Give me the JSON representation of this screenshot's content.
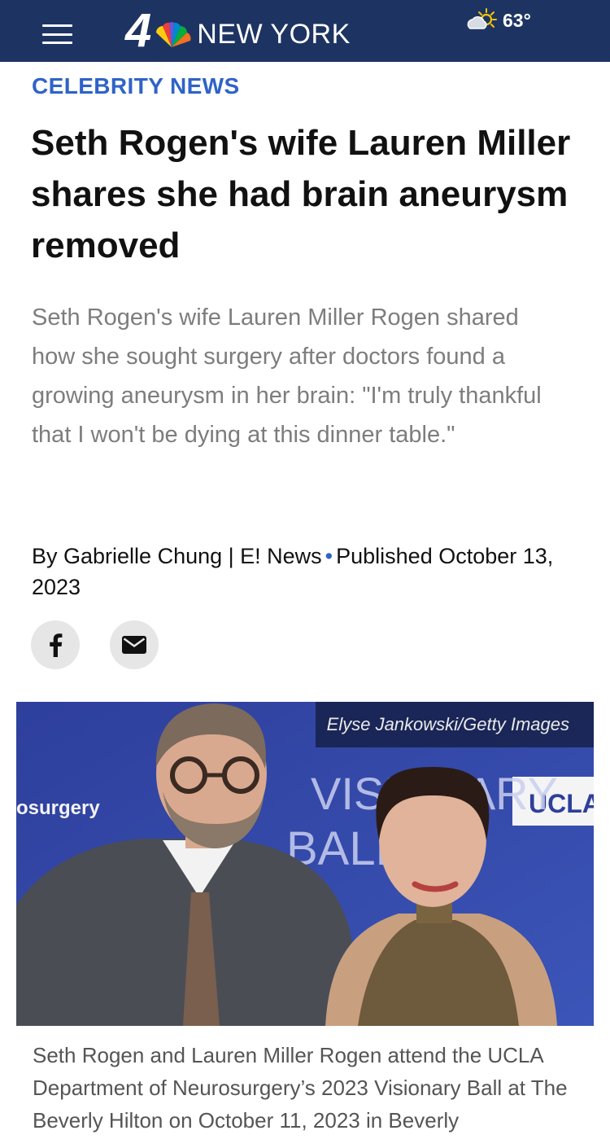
{
  "header": {
    "logo_number": "4",
    "logo_text": "NEW YORK",
    "weather_temp": "63°",
    "weather_icon": "partly-sunny-icon",
    "background_color": "#1d3463"
  },
  "article": {
    "category": "CELEBRITY NEWS",
    "headline": "Seth Rogen's wife Lauren Miller shares she had brain aneurysm removed",
    "dek": "Seth Rogen's wife Lauren Miller Rogen shared how she sought surgery after doctors found a growing aneurysm in her brain: \"I'm truly thankful that I won't be dying at this dinner table.\"",
    "byline_author": "By Gabrielle Chung | E! News",
    "byline_published": "Published October 13, 2023",
    "accent_color": "#2f63c8"
  },
  "share": {
    "facebook_icon": "facebook-icon",
    "email_icon": "email-icon"
  },
  "photo": {
    "credit": "Elyse Jankowski/Getty Images",
    "backdrop_text_left": "osurgery",
    "backdrop_text_ucla": "UCLA",
    "backdrop_text_visionary": "VISIONARY",
    "backdrop_text_ball": "BALL",
    "caption": "Seth Rogen and Lauren Miller Rogen attend the UCLA Department of Neurosurgery’s 2023 Visionary Ball at The Beverly Hilton on October 11, 2023 in Beverly"
  }
}
